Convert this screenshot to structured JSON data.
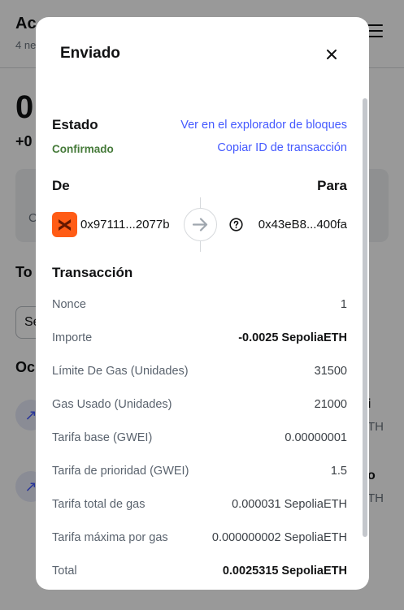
{
  "background": {
    "header_title": "Ac",
    "header_sub": "4 ne",
    "balance": "0",
    "change": "+0",
    "card_label": "C",
    "tokens_label": "To",
    "select_label": "Se",
    "activity_label": "Oc",
    "rows": [
      {
        "icon": "↗",
        "title": "i",
        "sub": "TH"
      },
      {
        "icon": "↗",
        "title": "o",
        "sub": "TH"
      }
    ]
  },
  "modal": {
    "title": "Enviado",
    "status_heading": "Estado",
    "status_value": "Confirmado",
    "explorer_link": "Ver en el explorador de bloques",
    "copy_link": "Copiar ID de transacción",
    "from_label": "De",
    "to_label": "Para",
    "from_address": "0x97111...2077b",
    "to_address": "0x43eB8...400fa",
    "transaction_heading": "Transacción",
    "rows": [
      {
        "label": "Nonce",
        "value": "1",
        "bold": false
      },
      {
        "label": "Importe",
        "value": "-0.0025 SepoliaETH",
        "bold": true
      },
      {
        "label": "Límite De Gas (Unidades)",
        "value": "31500",
        "bold": false
      },
      {
        "label": "Gas Usado (Unidades)",
        "value": "21000",
        "bold": false
      },
      {
        "label": "Tarifa base (GWEI)",
        "value": "0.00000001",
        "bold": false
      },
      {
        "label": "Tarifa de prioridad (GWEI)",
        "value": "1.5",
        "bold": false
      },
      {
        "label": "Tarifa total de gas",
        "value": "0.000031 SepoliaETH",
        "bold": false
      },
      {
        "label": "Tarifa máxima por gas",
        "value": "0.000000002 SepoliaETH",
        "bold": false
      },
      {
        "label": "Total",
        "value": "0.0025315 SepoliaETH",
        "bold": true
      }
    ]
  },
  "colors": {
    "accent_link": "#4459ff",
    "status_green": "#457a39",
    "from_icon_bg": "#ff5c16"
  },
  "icons": {
    "close": "close-icon",
    "arrow": "arrow-right-icon",
    "unknown_account": "question-circle-icon",
    "from_account": "metamask-fox-icon"
  }
}
